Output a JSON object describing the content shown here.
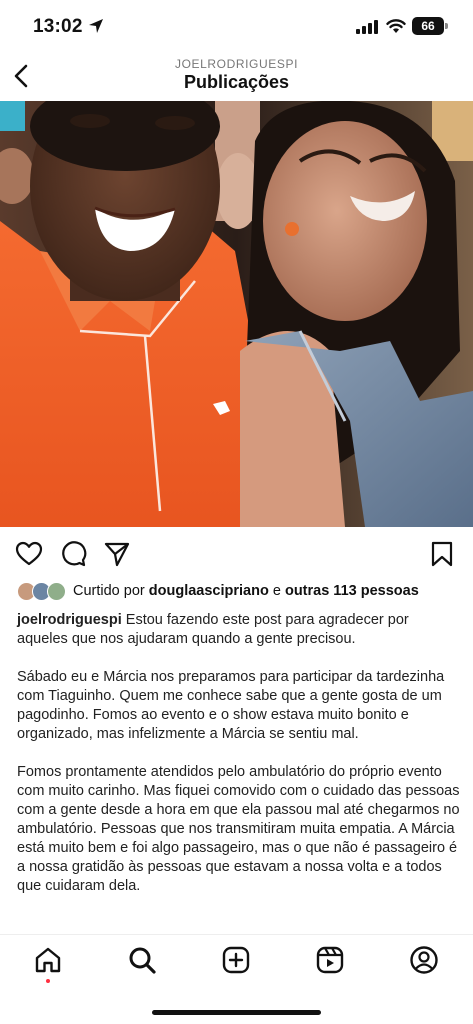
{
  "status_bar": {
    "time": "13:02",
    "battery": "66"
  },
  "header": {
    "username": "JOELRODRIGUESPI",
    "title": "Publicações"
  },
  "post": {
    "liked_by_prefix": "Curtido por",
    "liked_by_user": "douglaascipriano",
    "liked_by_connector": "e",
    "liked_by_others": "outras 113 pessoas",
    "caption_username": "joelrodriguespi",
    "caption_paragraphs": [
      "Estou fazendo este post para agradecer por aqueles que nos ajudaram quando a gente precisou.",
      "Sábado eu e Márcia nos preparamos para participar da tardezinha com Tiaguinho. Quem me conhece sabe que a gente gosta de um pagodinho. Fomos ao evento e o show estava muito bonito e organizado, mas infelizmente a Márcia se sentiu mal.",
      "Fomos prontamente atendidos pelo ambulatório do próprio evento com muito carinho. Mas fiquei comovido com o cuidado das pessoas com a gente desde a hora em que ela passou mal até chegarmos no ambulatório. Pessoas que nos transmitiram muita empatia. A Márcia está muito bem e foi algo passageiro, mas o que não é passageiro é a nossa gratidão às pessoas que estavam a nossa volta e a todos que cuidaram dela."
    ]
  },
  "icons": {
    "back": "chevron-left-icon",
    "like": "heart-icon",
    "comment": "comment-icon",
    "share": "send-icon",
    "save": "bookmark-icon",
    "nav": [
      "home-icon",
      "search-icon",
      "add-post-icon",
      "reels-icon",
      "profile-icon"
    ]
  },
  "colors": {
    "notification_dot": "#ff3040",
    "shirt": "#f0622a"
  }
}
